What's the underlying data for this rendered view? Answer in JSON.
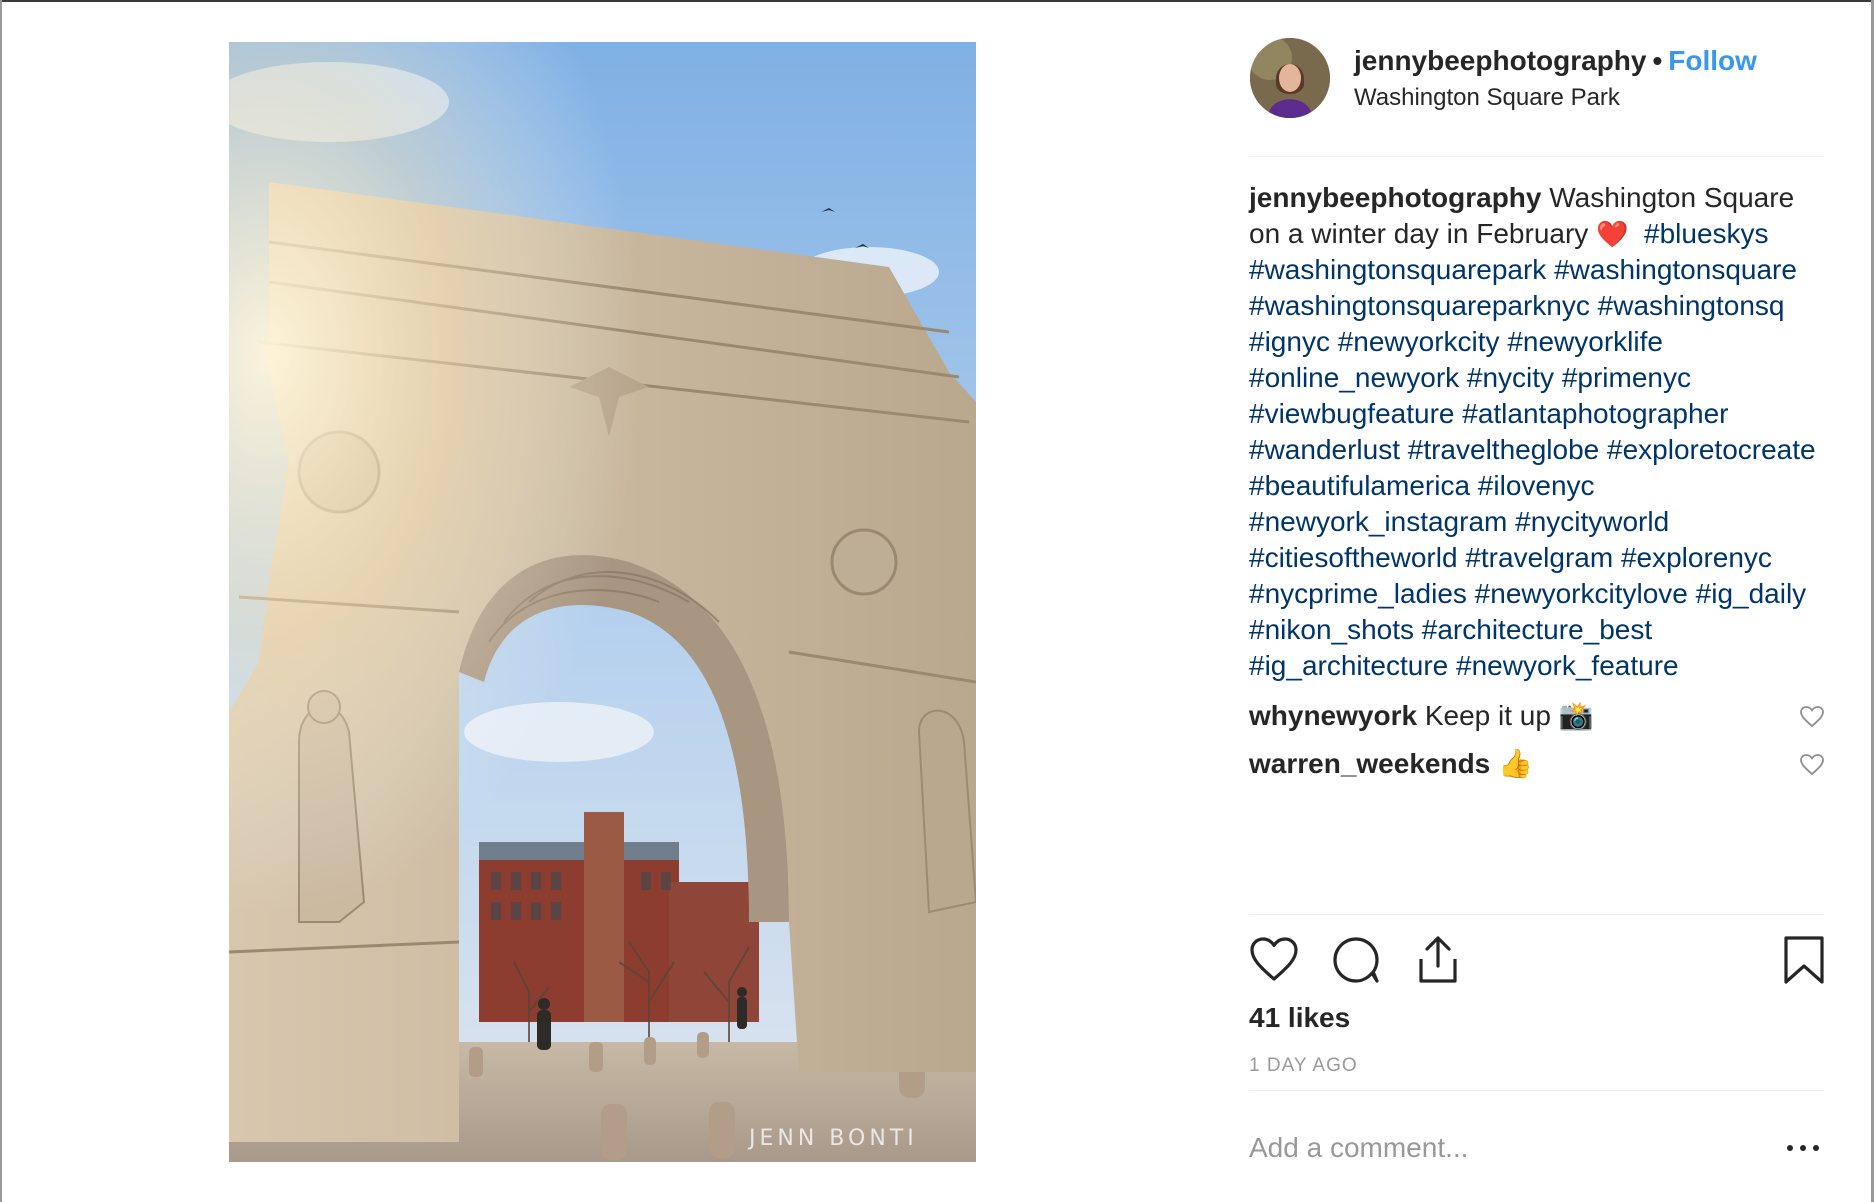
{
  "post": {
    "username": "jennybeephotography",
    "separator": "•",
    "follow_label": "Follow",
    "location": "Washington Square Park",
    "photo_watermark": "JENN BONTI"
  },
  "caption": {
    "username": "jennybeephotography",
    "text": "Washington Square on a winter day in February",
    "emoji": "❤️",
    "hashtags": "#blueskys #washingtonsquarepark #washingtonsquare #washingtonsquareparknyc #washingtonsq #ignyc #newyorkcity #newyorklife #online_newyork #nycity #primenyc #viewbugfeature #atlantaphotographer #wanderlust #traveltheglobe #exploretocreate #beautifulamerica #ilovenyc #newyork_instagram #nycityworld #citiesoftheworld #travelgram #explorenyc #nycprime_ladies #newyorkcitylove #ig_daily #nikon_shots #architecture_best #ig_architecture #newyork_feature"
  },
  "comments": [
    {
      "username": "whynewyork",
      "text": "Keep it up 📸"
    },
    {
      "username": "warren_weekends",
      "text": "👍"
    }
  ],
  "stats": {
    "likes": "41 likes",
    "time_ago": "1 DAY AGO"
  },
  "comment_box": {
    "placeholder": "Add a comment..."
  },
  "icons": {
    "like": "heart-icon",
    "comment": "comment-bubble-icon",
    "share": "share-upload-icon",
    "save": "bookmark-icon",
    "more": "more-options-icon",
    "comment_like": "small-heart-icon"
  },
  "colors": {
    "follow": "#3897f0",
    "hashtag": "#003569",
    "text": "#262626",
    "muted": "#999999",
    "divider": "#efefef"
  }
}
